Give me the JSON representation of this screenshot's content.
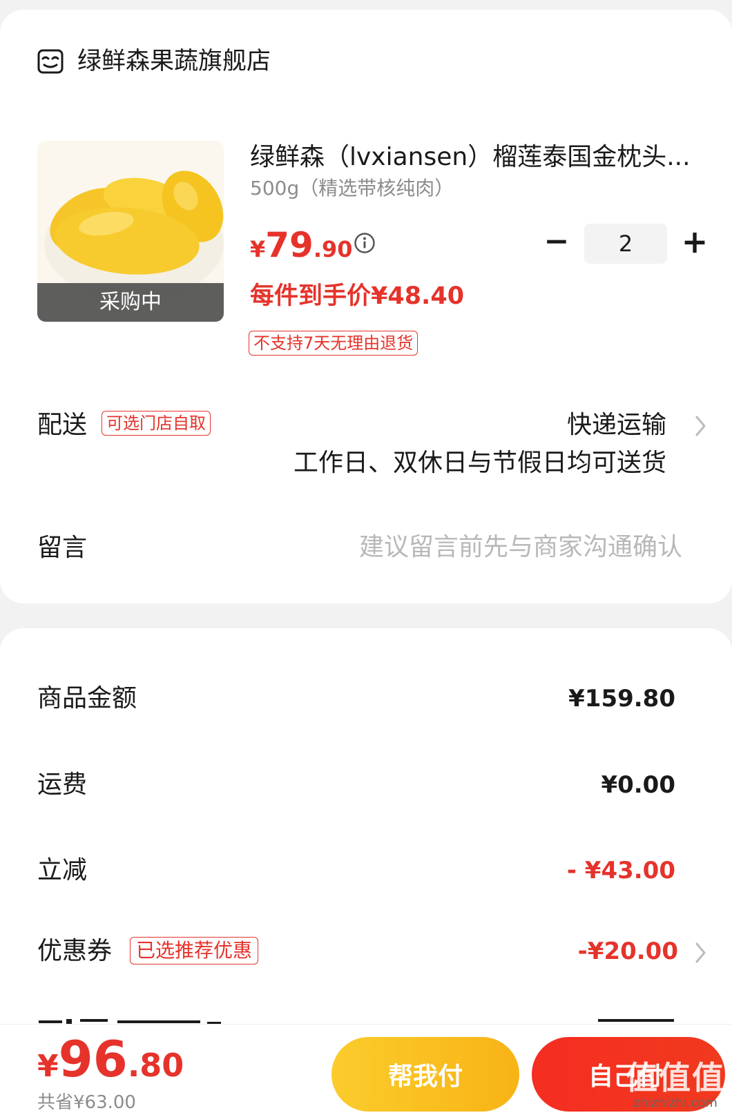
{
  "store": {
    "name": "绿鲜森果蔬旗舰店",
    "icon": "store-icon"
  },
  "product": {
    "image_badge": "采购中",
    "title": "绿鲜森（lvxiansen）榴莲泰国金枕头...",
    "variant": "500g（精选带核纯肉）",
    "price": {
      "currency": "¥",
      "integer": "79",
      "decimal": ".90"
    },
    "quantity": "2",
    "unit_price_label": "每件到手价¥48.40",
    "return_tag": "不支持7天无理由退货"
  },
  "delivery": {
    "label": "配送",
    "tag": "可选门店自取",
    "method": "快递运输",
    "note": "工作日、双休日与节假日均可送货"
  },
  "message": {
    "label": "留言",
    "placeholder": "建议留言前先与商家沟通确认"
  },
  "summary": {
    "goods_amount_label": "商品金额",
    "goods_amount_value": "¥159.80",
    "shipping_label": "运费",
    "shipping_value": "¥0.00",
    "discount_label": "立减",
    "discount_value": "- ¥43.00",
    "coupon_label": "优惠券",
    "coupon_tag": "已选推荐优惠",
    "coupon_value": "-¥20.00"
  },
  "footer": {
    "total": {
      "currency": "¥",
      "integer": "96",
      "decimal": ".80"
    },
    "savings": "共省¥63.00",
    "help_pay_button": "帮我付",
    "self_pay_button": "自己付"
  },
  "watermark": {
    "main": "值值值",
    "sub": "zhizhizhi.com"
  },
  "colors": {
    "accent_red": "#e5332b",
    "button_yellow": "#fbcc2c",
    "button_red": "#f52d22"
  }
}
